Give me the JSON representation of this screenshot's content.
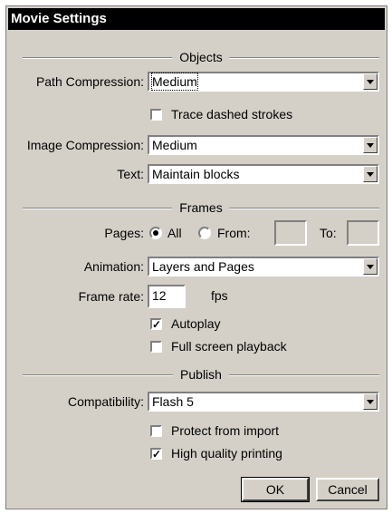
{
  "title": "Movie Settings",
  "objects": {
    "header": "Objects",
    "path_compression_label": "Path Compression:",
    "path_compression_value": "Medium",
    "trace_dashed_label": "Trace dashed strokes",
    "trace_dashed_checked": false,
    "image_compression_label": "Image Compression:",
    "image_compression_value": "Medium",
    "text_label": "Text:",
    "text_value": "Maintain blocks"
  },
  "frames": {
    "header": "Frames",
    "pages_label": "Pages:",
    "pages_all_label": "All",
    "pages_from_label": "From:",
    "pages_to_label": "To:",
    "pages_all_selected": true,
    "animation_label": "Animation:",
    "animation_value": "Layers and Pages",
    "frame_rate_label": "Frame rate:",
    "frame_rate_value": "12",
    "frame_rate_unit": "fps",
    "autoplay_label": "Autoplay",
    "autoplay_checked": true,
    "fullscreen_label": "Full screen playback",
    "fullscreen_checked": false
  },
  "publish": {
    "header": "Publish",
    "compatibility_label": "Compatibility:",
    "compatibility_value": "Flash 5",
    "protect_label": "Protect from import",
    "protect_checked": false,
    "hq_print_label": "High quality printing",
    "hq_print_checked": true
  },
  "buttons": {
    "ok": "OK",
    "cancel": "Cancel"
  },
  "icons": {
    "checkmark": "checkmark-icon",
    "dropdown": "dropdown-arrow-icon"
  },
  "colors": {
    "face": "#d4d0c8",
    "titlebar": "#000000",
    "field": "#ffffff"
  }
}
